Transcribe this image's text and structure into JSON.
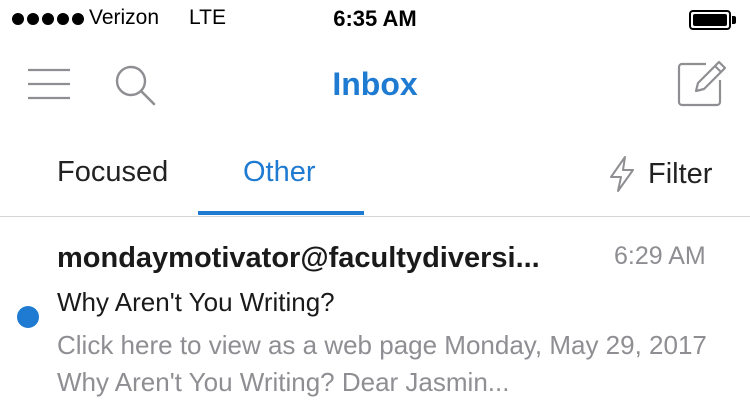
{
  "status_bar": {
    "carrier": "Verizon",
    "network": "LTE",
    "time": "6:35 AM",
    "battery_level": 1.0
  },
  "nav": {
    "title": "Inbox",
    "icons": [
      "menu-icon",
      "search-icon",
      "compose-icon"
    ]
  },
  "tabs": {
    "items": [
      {
        "label": "Focused",
        "active": false
      },
      {
        "label": "Other",
        "active": true
      }
    ],
    "filter_label": "Filter",
    "filter_icon": "lightning-icon"
  },
  "colors": {
    "accent": "#1f7bd1",
    "secondary_text": "#8e8e93",
    "divider": "#d4d4d4"
  },
  "messages": [
    {
      "sender": "mondaymotivator@facultydiversi...",
      "time": "6:29 AM",
      "subject": "Why Aren't You Writing?",
      "preview": "Click here to view as a web page Monday, May 29, 2017 Why Aren't You Writing? Dear Jasmin...",
      "unread": true
    }
  ]
}
